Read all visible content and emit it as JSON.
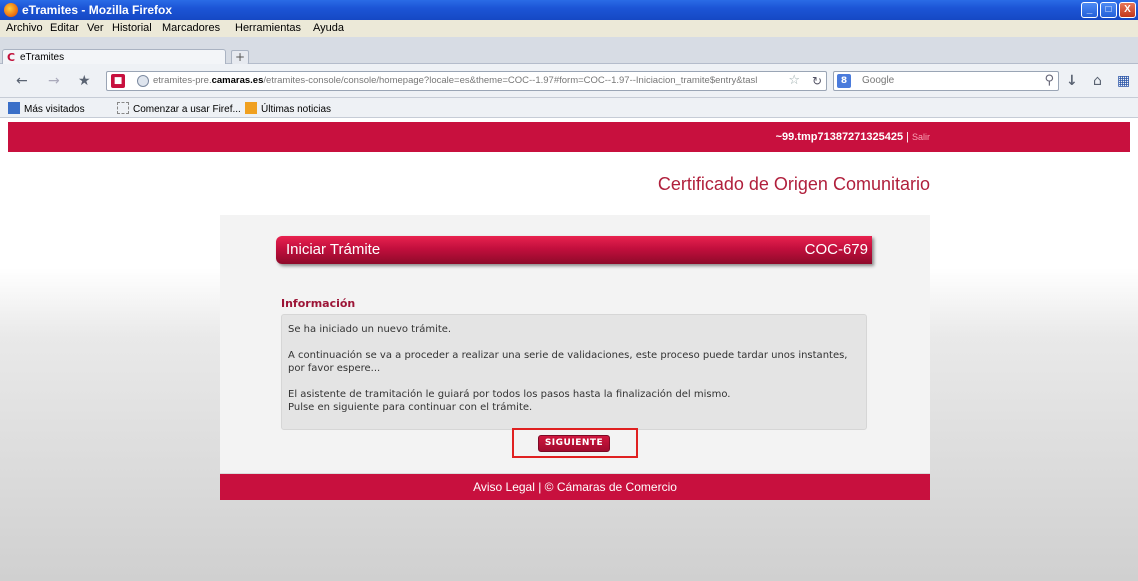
{
  "window": {
    "title": "eTramites - Mozilla Firefox",
    "buttons": {
      "minimize": "_",
      "maximize": "□",
      "close": "X"
    }
  },
  "menubar": {
    "items": [
      "Archivo",
      "Editar",
      "Ver",
      "Historial",
      "Marcadores",
      "Herramientas",
      "Ayuda"
    ]
  },
  "tabs": {
    "active_label": "eTramites",
    "new_tab": "+"
  },
  "navbar": {
    "url_prefix": "etramites-pre.",
    "url_domain": "camaras.es",
    "url_path": "/etramites-console/console/homepage?locale=es&theme=COC--1.97#form=COC--1.97--Iniciacion_tramite$entry&tasl",
    "search_placeholder": "Google",
    "icons": [
      "back-icon",
      "forward-icon",
      "identity-icon",
      "site-icon",
      "globe-icon",
      "star-icon",
      "reload-icon",
      "google-icon",
      "search-icon",
      "download-icon",
      "home-icon",
      "addon-icon"
    ]
  },
  "bookmarks": {
    "items": [
      "Más visitados",
      "Comenzar a usar Firef...",
      "Últimas noticias"
    ]
  },
  "page": {
    "user": "~99.tmp71387271325425",
    "separator": "|",
    "logout": "Salir",
    "heading": "Certificado de Origen Comunitario",
    "bar_title": "Iniciar Trámite",
    "bar_code": "COC-679",
    "info_title": "Información",
    "info_lines": [
      "Se ha iniciado un nuevo trámite.",
      "A continuación se va a proceder a realizar una serie de validaciones, este proceso puede tardar unos instantes, por favor espere...",
      "El asistente de tramitación le guiará por todos los pasos hasta la finalización del mismo.",
      "Pulse en siguiente para continuar con el trámite."
    ],
    "next_button": "SIGUIENTE",
    "footer": "Aviso Legal | © Cámaras de Comercio"
  },
  "colors": {
    "brand_red": "#c8103e",
    "heading_red": "#b01f3c",
    "highlight": "#e02020"
  }
}
